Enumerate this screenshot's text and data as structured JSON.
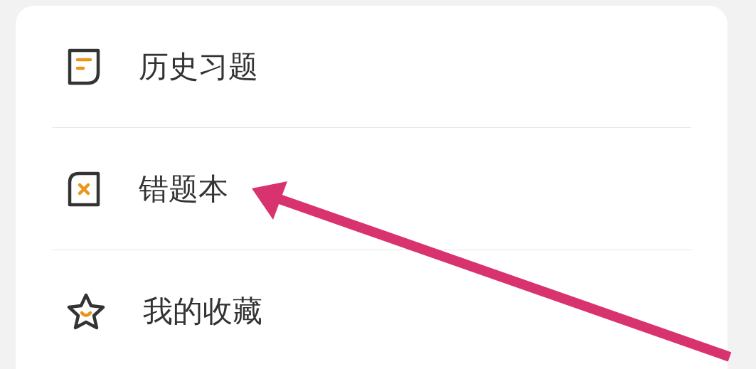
{
  "menu": {
    "items": [
      {
        "kind": "history",
        "label": "历史习题"
      },
      {
        "kind": "mistakes",
        "label": "错题本"
      },
      {
        "kind": "favorites",
        "label": "我的收藏"
      }
    ]
  }
}
